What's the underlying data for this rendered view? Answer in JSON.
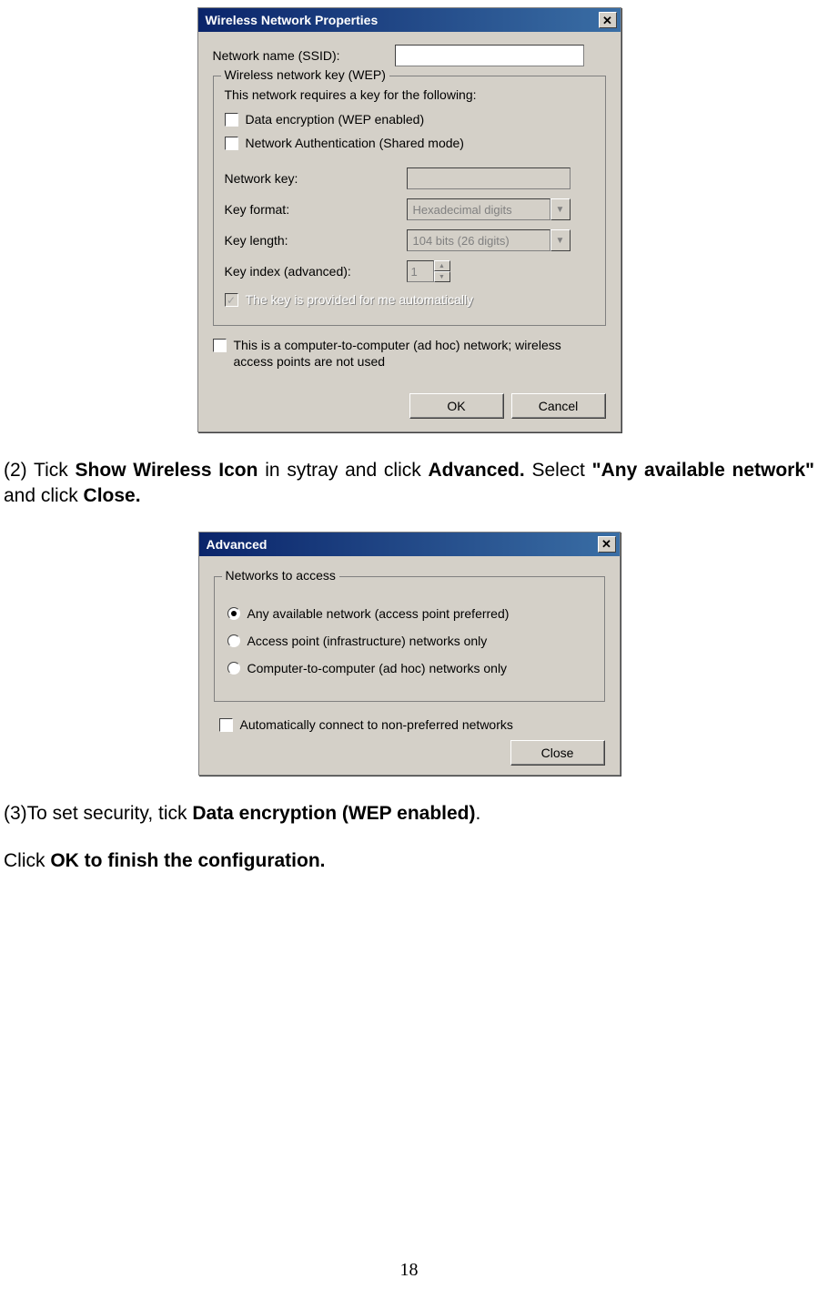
{
  "dialog1": {
    "title": "Wireless Network Properties",
    "ssid_label": "Network name (SSID):",
    "ssid_value": "",
    "wep_group_title": "Wireless network key (WEP)",
    "wep_intro": "This network requires a key for the following:",
    "chk_data_enc": "Data encryption (WEP enabled)",
    "chk_net_auth": "Network Authentication (Shared mode)",
    "network_key_label": "Network key:",
    "network_key_value": "",
    "key_format_label": "Key format:",
    "key_format_value": "Hexadecimal digits",
    "key_length_label": "Key length:",
    "key_length_value": "104 bits (26 digits)",
    "key_index_label": "Key index (advanced):",
    "key_index_value": "1",
    "auto_key_label": "The key is provided for me automatically",
    "adhoc_label": "This is a computer-to-computer (ad hoc) network; wireless access points are not used",
    "ok_btn": "OK",
    "cancel_btn": "Cancel"
  },
  "step2": {
    "prefix": "(2)  Tick  ",
    "b1": "Show  Wireless  Icon",
    "mid1": "  in  sytray  and  click  ",
    "b2": "Advanced.",
    "mid2": "  Select  ",
    "b3": "\"Any available network\"",
    "mid3": " and click ",
    "b4": "Close."
  },
  "dialog2": {
    "title": "Advanced",
    "group_title": "Networks to access",
    "opt1": "Any available network (access point preferred)",
    "opt2": "Access point (infrastructure) networks only",
    "opt3": "Computer-to-computer (ad hoc) networks only",
    "auto_connect": "Automatically connect to non-preferred networks",
    "close_btn": "Close"
  },
  "step3": {
    "prefix": "(3)To set security, tick ",
    "b1": "Data encryption (WEP enabled)",
    "suffix": "."
  },
  "step_final": {
    "prefix": "Click ",
    "b1": "OK to finish the configuration."
  },
  "page_number": "18"
}
